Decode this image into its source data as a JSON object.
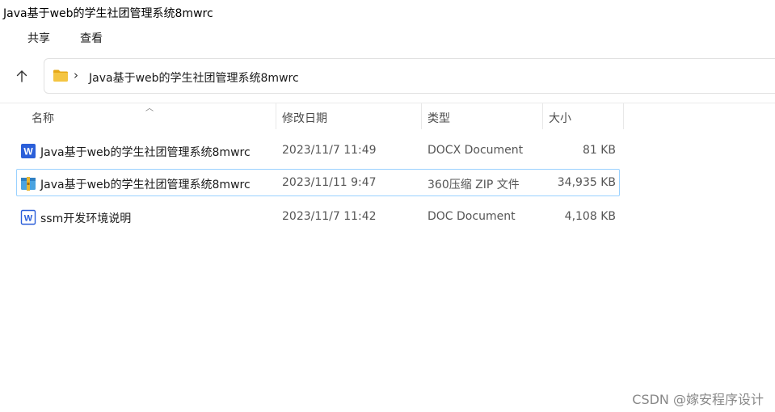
{
  "window": {
    "title": "Java基于web的学生社团管理系统8mwrc"
  },
  "ribbon": {
    "tabs": [
      {
        "label": "共享"
      },
      {
        "label": "查看"
      }
    ]
  },
  "address": {
    "up_icon": "up-arrow-icon",
    "folder_icon": "folder-icon",
    "chevron": "›",
    "path": "Java基于web的学生社团管理系统8mwrc"
  },
  "columns": {
    "name": "名称",
    "date": "修改日期",
    "type": "类型",
    "size": "大小"
  },
  "files": [
    {
      "icon": "word-docx-icon",
      "name": "Java基于web的学生社团管理系统8mwrc",
      "date": "2023/11/7 11:49",
      "type": "DOCX Document",
      "size": "81 KB"
    },
    {
      "icon": "zip-archive-icon",
      "name": "Java基于web的学生社团管理系统8mwrc",
      "date": "2023/11/11 9:47",
      "type": "360压缩 ZIP 文件",
      "size": "34,935 KB"
    },
    {
      "icon": "word-doc-icon",
      "name": "ssm开发环境说明",
      "date": "2023/11/7 11:42",
      "type": "DOC Document",
      "size": "4,108 KB"
    }
  ],
  "watermark": "CSDN @嫁安程序设计",
  "colors": {
    "selection_border": "#99d1ff",
    "word_blue": "#2b5fd9",
    "folder_yellow": "#f4c542"
  }
}
